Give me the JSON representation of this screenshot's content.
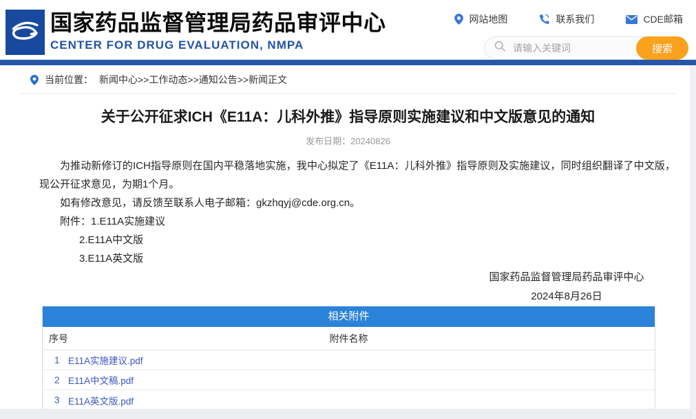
{
  "header": {
    "org_name_zh": "国家药品监督管理局药品审评中心",
    "org_name_en": "CENTER FOR DRUG EVALUATION, NMPA",
    "quick_links": [
      {
        "label": "网站地图",
        "icon": "map-pin-icon"
      },
      {
        "label": "联系我们",
        "icon": "phone-icon"
      },
      {
        "label": "CDE邮箱",
        "icon": "mail-icon"
      }
    ],
    "search": {
      "placeholder": "请输入关键词",
      "button_label": "搜索"
    }
  },
  "breadcrumb": {
    "prefix": "当前位置：",
    "path": "新闻中心>>工作动态>>通知公告>>新闻正文"
  },
  "article": {
    "title": "关于公开征求ICH《E11A：儿科外推》指导原则实施建议和中文版意见的通知",
    "date_label": "发布日期：",
    "date_value": "20240826",
    "paragraph_1": "为推动新修订的ICH指导原则在国内平稳落地实施，我中心拟定了《E11A：儿科外推》指导原则及实施建议，同时组织翻译了中文版，现公开征求意见，为期1个月。",
    "paragraph_2": "如有修改意见，请反馈至联系人电子邮箱：gkzhqyj@cde.org.cn。",
    "attachments_label": "附件：",
    "attachment_items": [
      "1.E11A实施建议",
      "2.E11A中文版",
      "3.E11A英文版"
    ],
    "signer": "国家药品监督管理局药品审评中心",
    "sign_date": "2024年8月26日"
  },
  "attachments_table": {
    "title": "相关附件",
    "col_no": "序号",
    "col_name": "附件名称",
    "rows": [
      {
        "no": "1",
        "file": "E11A实施建议.pdf"
      },
      {
        "no": "2",
        "file": "E11A中文稿.pdf"
      },
      {
        "no": "3",
        "file": "E11A英文版.pdf"
      }
    ]
  },
  "colors": {
    "logo_blue": "#17499e",
    "subtitle_blue": "#2353a4",
    "divider_bar_blue": "#2857a8",
    "table_header_blue": "#2a82d9",
    "link_blue": "#3a57c4",
    "icon_blue": "#3a78d2",
    "search_button_orange": "#faa21d"
  }
}
